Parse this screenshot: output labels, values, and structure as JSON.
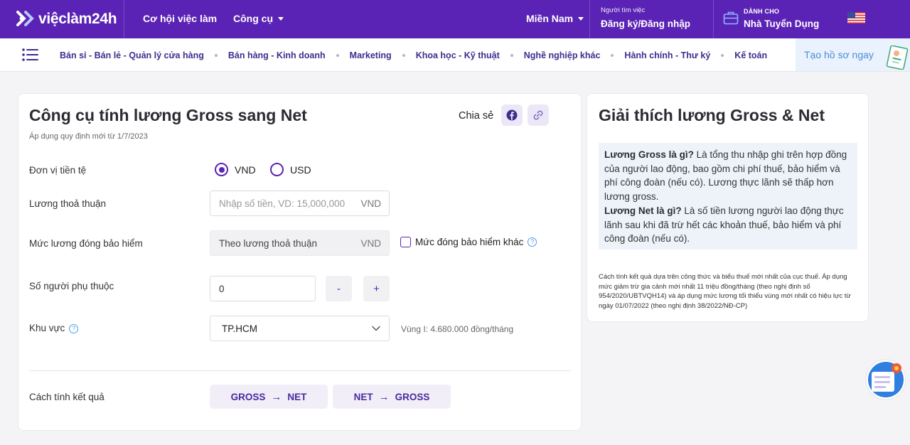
{
  "header": {
    "logo_text": "việclàm24h",
    "nav_opportunities": "Cơ hội việc làm",
    "nav_tools": "Công cụ",
    "nav_region": "Miền Nam",
    "seeker_small": "Người tìm việc",
    "seeker_action": "Đăng ký/Đăng nhập",
    "employer_small": "DÀNH CHO",
    "employer_action": "Nhà Tuyển Dụng"
  },
  "categories": [
    "Bán sỉ - Bán lẻ - Quản lý cửa hàng",
    "Bán hàng - Kinh doanh",
    "Marketing",
    "Khoa học - Kỹ thuật",
    "Nghề nghiệp khác",
    "Hành chính - Thư ký",
    "Kế toán"
  ],
  "cta_create_profile": "Tạo hồ sơ ngay",
  "calculator": {
    "title": "Công cụ tính lương Gross sang Net",
    "subtitle": "Áp dụng quy định mới từ 1/7/2023",
    "share_label": "Chia sẻ",
    "currency_label": "Đơn vị tiền tệ",
    "currency_options": [
      "VND",
      "USD"
    ],
    "currency_selected": "VND",
    "salary_label": "Lương thoả thuận",
    "salary_placeholder": "Nhập số tiền, VD: 15,000,000",
    "salary_suffix": "VND",
    "insurance_label": "Mức lương đóng bảo hiểm",
    "insurance_value": "Theo lương thoả thuận",
    "insurance_suffix": "VND",
    "insurance_other_label": "Mức đóng bảo hiểm khác",
    "dependents_label": "Số người phụ thuộc",
    "dependents_value": "0",
    "minus": "-",
    "plus": "+",
    "region_label": "Khu vực",
    "region_value": "TP.HCM",
    "region_note": "Vùng I: 4.680.000 đồng/tháng",
    "method_label": "Cách tính kết quả",
    "btn_gross_net": {
      "from": "GROSS",
      "arrow": "→",
      "to": "NET"
    },
    "btn_net_gross": {
      "from": "NET",
      "arrow": "→",
      "to": "GROSS"
    }
  },
  "explain": {
    "title": "Giải thích lương Gross & Net",
    "gross_q": "Lương Gross là gì?",
    "gross_a": " Là tổng thu nhập ghi trên hợp đồng của người lao động, bao gồm chi phí thuế, bảo hiểm và phí công đoàn (nếu có). Lương thực lãnh sẽ thấp hơn lương gross.",
    "net_q": "Lương Net là gì?",
    "net_a": " Là số tiền lương người lao động thực lãnh sau khi đã trừ hết các khoản thuế, bảo hiểm và phí công đoàn (nếu có).",
    "note": "Cách tính kết quả dựa trên công thức và biểu thuế mới nhất của cục thuế. Áp dụng mức giảm trừ gia cảnh mới nhất 11 triệu đồng/tháng (theo nghị định số 954/2020/UBTVQH14) và áp dụng mức lương tối thiểu vùng mới nhất có hiệu lực từ ngày 01/07/2022 (theo nghị định 38/2022/NĐ-CP)"
  },
  "colors": {
    "brand_purple": "#5b23b5",
    "category_text": "#3e2d8f",
    "cta_bg": "#eaf3fd",
    "cta_text": "#4e88d8",
    "explain_bg": "#eef3f9"
  }
}
